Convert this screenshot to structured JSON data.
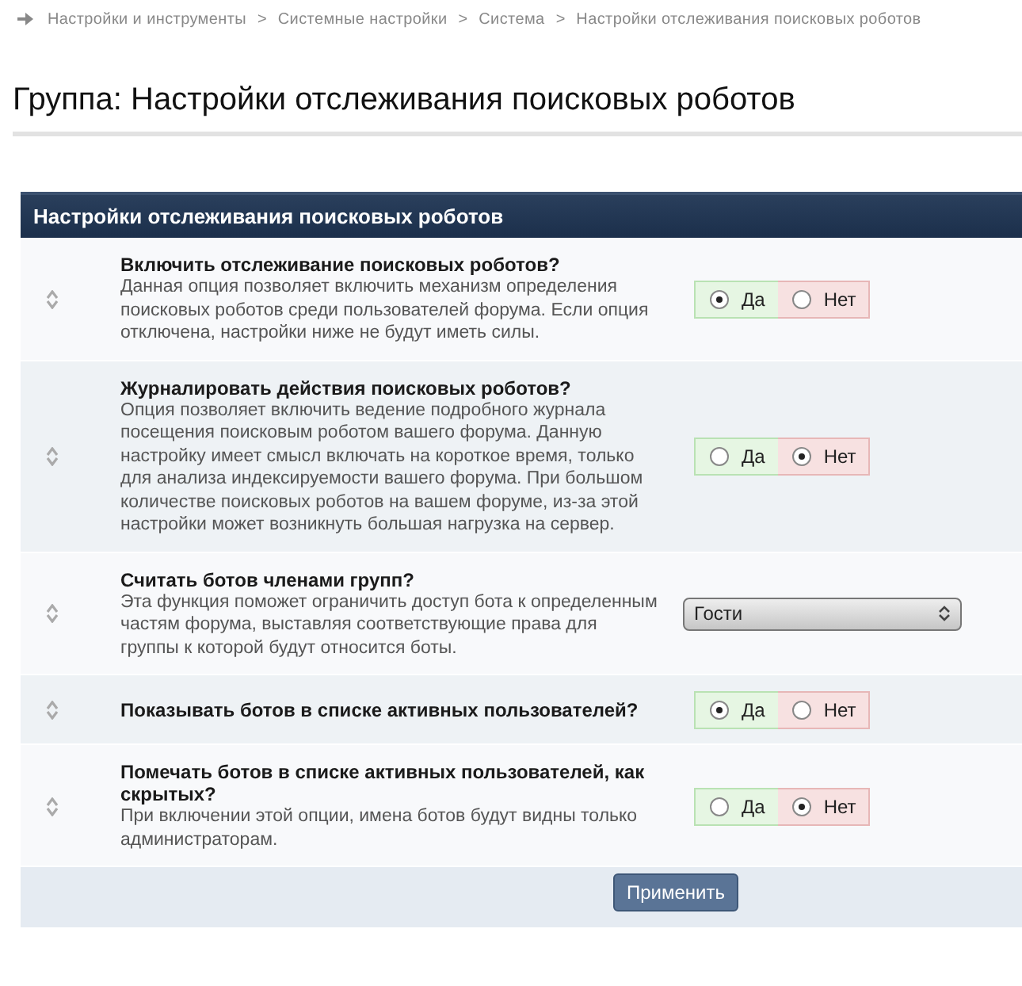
{
  "breadcrumb": [
    "Настройки и инструменты",
    "Системные настройки",
    "Система",
    "Настройки отслеживания поисковых роботов"
  ],
  "breadcrumb_separator": ">",
  "page_title": "Группа: Настройки отслеживания поисковых роботов",
  "panel": {
    "title": "Настройки отслеживания поисковых роботов",
    "settings": [
      {
        "kind": "yesno",
        "title": "Включить отслеживание поисковых роботов?",
        "description": "Данная опция позволяет включить механизм определения поисковых роботов среди пользователей форума. Если опция отключена, настройки ниже не будут иметь силы.",
        "options": [
          {
            "label": "Да",
            "selected": true
          },
          {
            "label": "Нет",
            "selected": false
          }
        ]
      },
      {
        "kind": "yesno",
        "title": "Журналировать действия поисковых роботов?",
        "description": "Опция позволяет включить ведение подробного журнала посещения поисковым роботом вашего форума. Данную настройку имеет смысл включать на короткое время, только для анализа индексируемости вашего форума. При большом количестве поисковых роботов на вашем форуме, из-за этой настройки может возникнуть большая нагрузка на сервер.",
        "options": [
          {
            "label": "Да",
            "selected": false
          },
          {
            "label": "Нет",
            "selected": true
          }
        ]
      },
      {
        "kind": "select",
        "title": "Считать ботов членами групп?",
        "description": "Эта функция поможет ограничить доступ бота к определенным частям форума, выставляя соответствующие права для группы к которой будут относится боты.",
        "value": "Гости"
      },
      {
        "kind": "yesno",
        "title": "Показывать ботов в списке активных пользователей?",
        "options": [
          {
            "label": "Да",
            "selected": true
          },
          {
            "label": "Нет",
            "selected": false
          }
        ]
      },
      {
        "kind": "yesno",
        "title": "Помечать ботов в списке активных пользователей, как скрытых?",
        "description": "При включении этой опции, имена ботов будут видны только администраторам.",
        "options": [
          {
            "label": "Да",
            "selected": false
          },
          {
            "label": "Нет",
            "selected": true
          }
        ]
      }
    ],
    "submit_button": "Применить"
  }
}
